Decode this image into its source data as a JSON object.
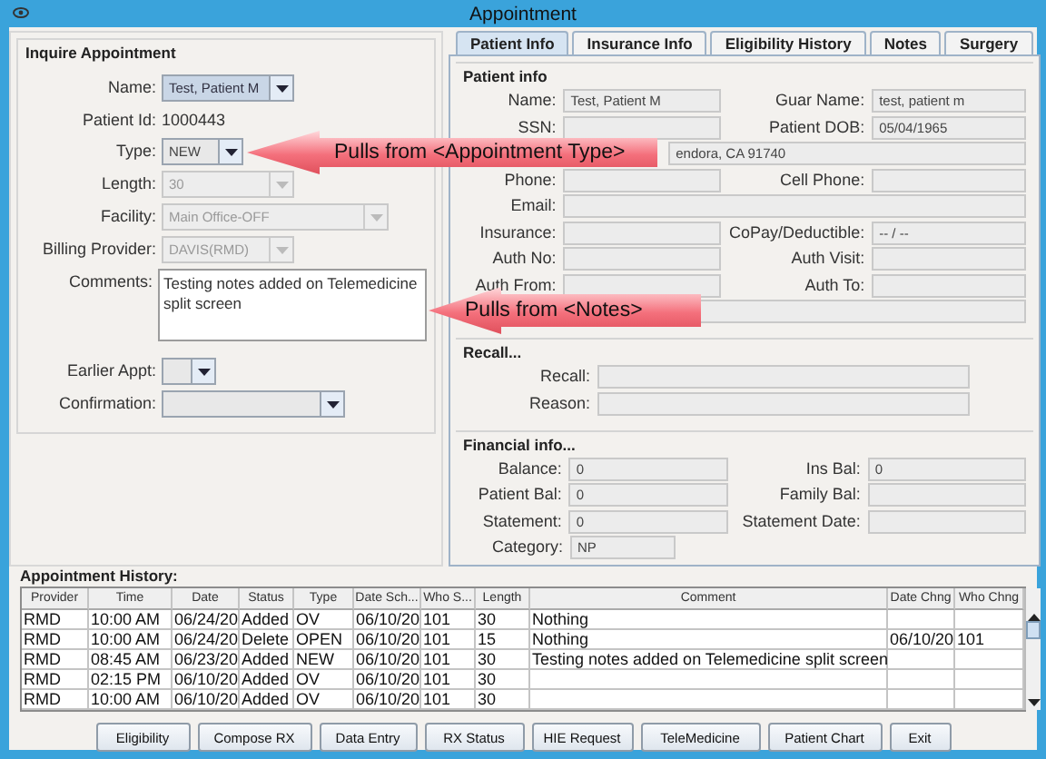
{
  "window": {
    "title": "Appointment"
  },
  "inquire": {
    "title": "Inquire Appointment",
    "fields": [
      {
        "kind": "combo",
        "label": "Name:",
        "value": "Test, Patient M",
        "disabled": false
      },
      {
        "kind": "text",
        "label": "Patient Id:",
        "value": "1000443"
      },
      {
        "kind": "combo",
        "label": "Type:",
        "value": "NEW",
        "disabled": false
      },
      {
        "kind": "combo",
        "label": "Length:",
        "value": "30",
        "disabled": true
      },
      {
        "kind": "combo",
        "label": "Facility:",
        "value": "Main Office-OFF",
        "disabled": true
      },
      {
        "kind": "combo",
        "label": "Billing Provider:",
        "value": "DAVIS(RMD)",
        "disabled": true
      },
      {
        "kind": "textarea",
        "label": "Comments:",
        "value": "Testing notes added on Telemedicine split screen"
      },
      {
        "kind": "combo",
        "label": "Earlier Appt:",
        "disabled": false
      },
      {
        "kind": "combo",
        "label": "Confirmation:",
        "disabled": false
      }
    ]
  },
  "tabs": [
    {
      "label": "Patient Info",
      "selected": true
    },
    {
      "label": "Insurance Info",
      "selected": false
    },
    {
      "label": "Eligibility History",
      "selected": false
    },
    {
      "label": "Notes",
      "selected": false
    },
    {
      "label": "Surgery",
      "selected": false
    }
  ],
  "groups": [
    {
      "title": "Patient info",
      "rows": [
        {
          "kind": "pair",
          "cells": [
            {
              "label": "Name:",
              "value": "Test, Patient M"
            },
            {
              "label": "Guar Name:",
              "value": "test, patient m"
            }
          ]
        },
        {
          "kind": "pair",
          "cells": [
            {
              "label": "SSN:"
            },
            {
              "label": "Patient DOB:",
              "value": "05/04/1965"
            }
          ]
        },
        {
          "kind": "wide",
          "value": "endora, CA 91740"
        },
        {
          "kind": "pair",
          "cells": [
            {
              "label": "Phone:"
            },
            {
              "label": "Cell Phone:"
            }
          ]
        },
        {
          "kind": "wide",
          "label": "Email:"
        },
        {
          "kind": "pair",
          "cells": [
            {
              "label": "Insurance:"
            },
            {
              "label": "CoPay/Deductible:",
              "value": "-- / --"
            }
          ]
        },
        {
          "kind": "pair",
          "cells": [
            {
              "label": "Auth No:"
            },
            {
              "label": "Auth Visit:"
            }
          ]
        },
        {
          "kind": "pair",
          "cells": [
            {
              "label": "Auth From:"
            },
            {
              "label": "Auth To:"
            }
          ]
        },
        {
          "kind": "wide"
        }
      ]
    },
    {
      "title": "Recall...",
      "rows": [
        {
          "kind": "medium",
          "label": "Recall:"
        },
        {
          "kind": "medium",
          "label": "Reason:"
        }
      ]
    },
    {
      "title": "Financial info...",
      "rows": [
        {
          "kind": "pair",
          "cells": [
            {
              "label": "Balance:",
              "value": "0"
            },
            {
              "label": "Ins Bal:",
              "value": "0"
            }
          ]
        },
        {
          "kind": "pair",
          "cells": [
            {
              "label": "Patient Bal:",
              "value": "0"
            },
            {
              "label": "Family Bal:"
            }
          ]
        },
        {
          "kind": "pair",
          "cells": [
            {
              "label": "Statement:",
              "value": "0"
            },
            {
              "label": "Statement Date:"
            }
          ]
        },
        {
          "kind": "short",
          "label": "Category:",
          "value": "NP"
        }
      ]
    }
  ],
  "history": {
    "title": "Appointment History:",
    "columns": [
      "Provider",
      "Time",
      "Date",
      "Status",
      "Type",
      "Date Sch...",
      "Who S...",
      "Length",
      "Comment",
      "Date Chng",
      "Who Chng"
    ],
    "rows": [
      {
        "provider": "RMD",
        "time": "10:00 AM",
        "date": "06/24/20",
        "status": "Added",
        "type": "OV",
        "date_sch": "06/10/20",
        "who_s": "101",
        "length": "30",
        "comment": "Nothing"
      },
      {
        "provider": "RMD",
        "time": "10:00 AM",
        "date": "06/24/20",
        "status": "Delete",
        "type": "OPEN",
        "date_sch": "06/10/20",
        "who_s": "101",
        "length": "15",
        "comment": "Nothing",
        "date_chng": "06/10/20",
        "who_chng": "101"
      },
      {
        "provider": "RMD",
        "time": "08:45 AM",
        "date": "06/23/20",
        "status": "Added",
        "type": "NEW",
        "date_sch": "06/10/20",
        "who_s": "101",
        "length": "30",
        "comment": "Testing notes added on Telemedicine split screen"
      },
      {
        "provider": "RMD",
        "time": "02:15 PM",
        "date": "06/10/20",
        "status": "Added",
        "type": "OV",
        "date_sch": "06/10/20",
        "who_s": "101",
        "length": "30"
      },
      {
        "provider": "RMD",
        "time": "10:00 AM",
        "date": "06/10/20",
        "status": "Added",
        "type": "OV",
        "date_sch": "06/10/20",
        "who_s": "101",
        "length": "30"
      }
    ]
  },
  "buttons": [
    "Eligibility",
    "Compose RX",
    "Data Entry",
    "RX Status",
    "HIE Request",
    "TeleMedicine",
    "Patient Chart",
    "Exit"
  ],
  "callouts": [
    {
      "text": "Pulls from <Appointment Type>"
    },
    {
      "text": "Pulls from <Notes>"
    }
  ]
}
